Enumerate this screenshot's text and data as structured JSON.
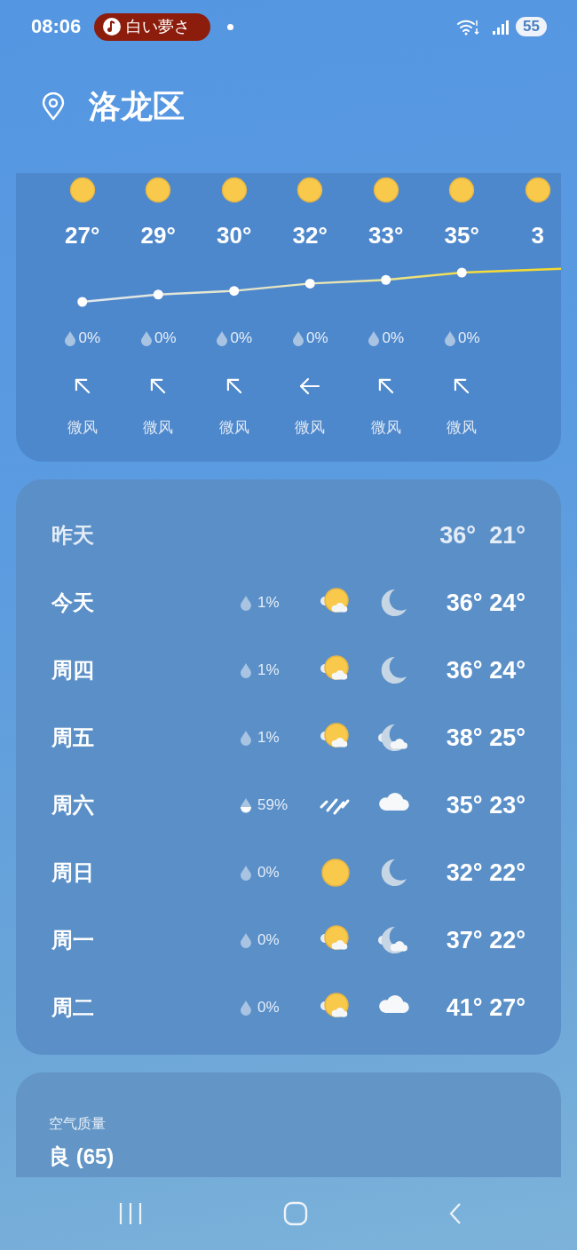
{
  "status_bar": {
    "time": "08:06",
    "media_chip": "白い夢さ",
    "battery": "55"
  },
  "location": {
    "name": "洛龙区"
  },
  "hourly": [
    {
      "kind": "northwest",
      "temp": "27°",
      "precip": "0%",
      "wind": "微风"
    },
    {
      "kind": "northwest",
      "temp": "29°",
      "precip": "0%",
      "wind": "微风"
    },
    {
      "kind": "northwest",
      "temp": "30°",
      "precip": "0%",
      "wind": "微风"
    },
    {
      "kind": "west",
      "temp": "32°",
      "precip": "0%",
      "wind": "微风"
    },
    {
      "kind": "northwest",
      "temp": "33°",
      "precip": "0%",
      "wind": "微风"
    },
    {
      "kind": "northwest",
      "temp": "35°",
      "precip": "0%",
      "wind": "微风"
    },
    {
      "kind": "partial",
      "temp": "3"
    }
  ],
  "daily": [
    {
      "day": "昨天",
      "dimmed": true,
      "temps": "36°  21°"
    },
    {
      "day": "今天",
      "dimmed": false,
      "precip": "1%",
      "icons": [
        {
          "kind": "drop"
        },
        {
          "kind": "suncloud"
        },
        {
          "kind": "moon"
        }
      ],
      "temps": "36° 24°"
    },
    {
      "day": "周四",
      "dimmed": false,
      "precip": "1%",
      "icons": [
        {
          "kind": "drop"
        },
        {
          "kind": "suncloud"
        },
        {
          "kind": "moon"
        }
      ],
      "temps": "36° 24°"
    },
    {
      "day": "周五",
      "dimmed": false,
      "precip": "1%",
      "icons": [
        {
          "kind": "drop"
        },
        {
          "kind": "suncloud"
        },
        {
          "kind": "mooncloud"
        }
      ],
      "temps": "38° 25°"
    },
    {
      "day": "周六",
      "dimmed": false,
      "precip": "59%",
      "icons": [
        {
          "kind": "halfdrop"
        },
        {
          "kind": "rain"
        },
        {
          "kind": "cloud"
        }
      ],
      "temps": "35° 23°"
    },
    {
      "day": "周日",
      "dimmed": false,
      "precip": "0%",
      "icons": [
        {
          "kind": "drop"
        },
        {
          "kind": "sun"
        },
        {
          "kind": "moon"
        }
      ],
      "temps": "32° 22°"
    },
    {
      "day": "周一",
      "dimmed": false,
      "precip": "0%",
      "icons": [
        {
          "kind": "drop"
        },
        {
          "kind": "suncloud"
        },
        {
          "kind": "mooncloud"
        }
      ],
      "temps": "37° 22°"
    },
    {
      "day": "周二",
      "dimmed": false,
      "precip": "0%",
      "icons": [
        {
          "kind": "drop"
        },
        {
          "kind": "suncloud"
        },
        {
          "kind": "cloud"
        }
      ],
      "temps": "41° 27°"
    }
  ],
  "air_quality": {
    "label": "空气质量",
    "value": "良 (65)"
  }
}
